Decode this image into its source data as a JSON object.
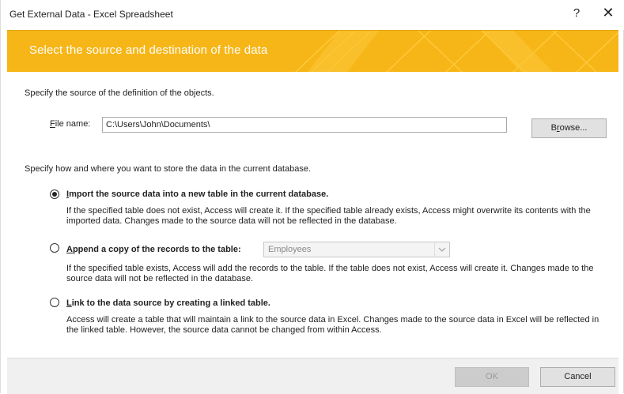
{
  "window": {
    "title": "Get External Data - Excel Spreadsheet",
    "help": "?",
    "close": "✕"
  },
  "banner": {
    "text": "Select the source and destination of the data",
    "color": "#f7b617"
  },
  "source": {
    "prompt": "Specify the source of the definition of the objects.",
    "file_label_accel": "F",
    "file_label_rest": "ile name:",
    "file_value": "C:\\Users\\John\\Documents\\",
    "browse_pre": "B",
    "browse_accel": "r",
    "browse_post": "owse..."
  },
  "store": {
    "prompt": "Specify how and where you want to store the data in the current database.",
    "options": [
      {
        "accel": "I",
        "label_rest": "mport the source data into a new table in the current database.",
        "desc": "If the specified table does not exist, Access will create it. If the specified table already exists, Access might overwrite its contents with the imported data. Changes made to the source data will not be reflected in the database.",
        "selected": true
      },
      {
        "accel": "A",
        "label_rest": "ppend a copy of the records to the table:",
        "desc": "If the specified table exists, Access will add the records to the table. If the table does not exist, Access will create it. Changes made to the source data will not be reflected in the database.",
        "selected": false,
        "table_value": "Employees"
      },
      {
        "accel": "L",
        "label_rest": "ink to the data source by creating a linked table.",
        "desc": "Access will create a table that will maintain a link to the source data in Excel. Changes made to the source data in Excel will be reflected in the linked table. However, the source data cannot be changed from within Access.",
        "selected": false
      }
    ]
  },
  "footer": {
    "ok": "OK",
    "cancel": "Cancel"
  }
}
